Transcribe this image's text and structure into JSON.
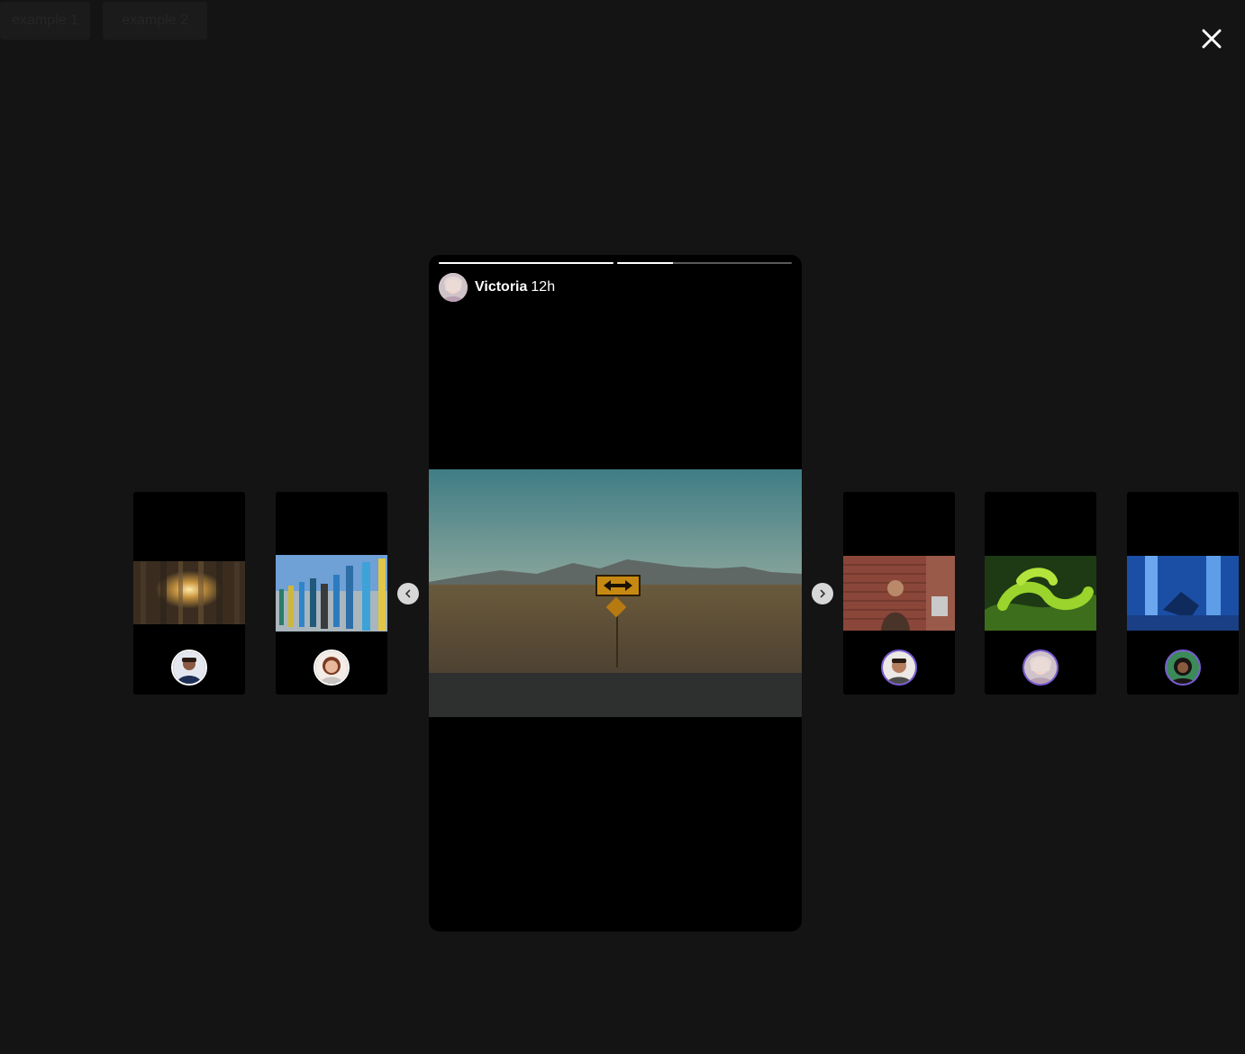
{
  "top_buttons": [
    "example 1",
    "example 2"
  ],
  "story": {
    "user": "Victoria",
    "time": "12h",
    "progress": [
      1.0,
      0.32
    ]
  },
  "icons": {
    "close": "close-icon",
    "prev": "chevron-left-icon",
    "next": "chevron-right-icon"
  },
  "colors": {
    "background": "#141414",
    "unseen_ring": "#7b5cd6"
  }
}
